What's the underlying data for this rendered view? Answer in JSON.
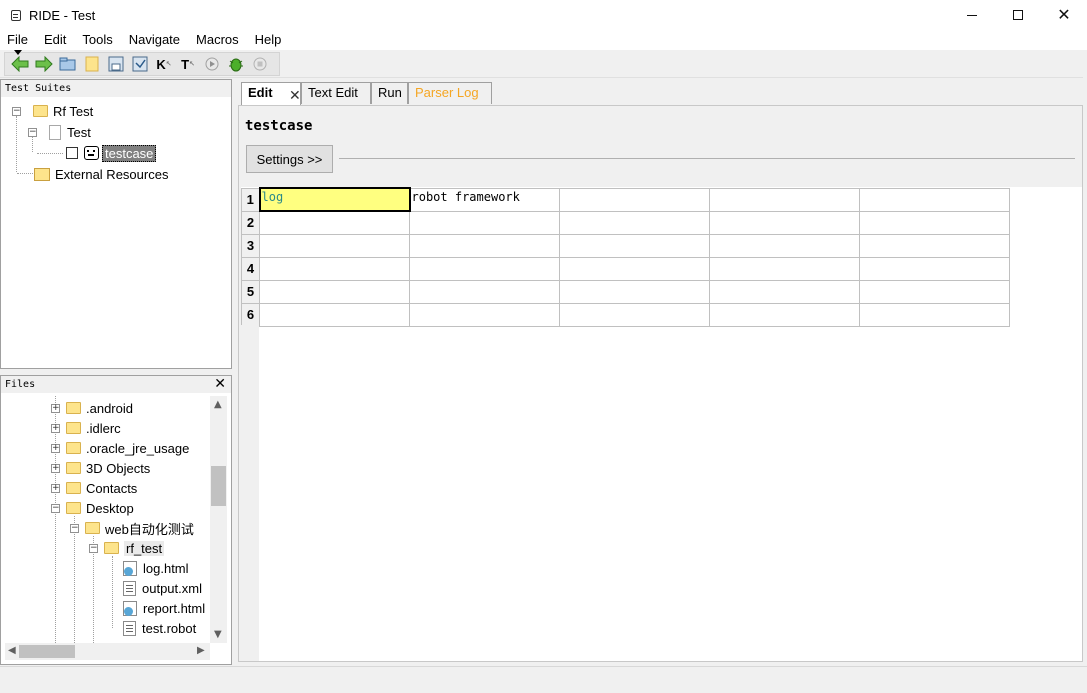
{
  "window": {
    "title": "RIDE - Test"
  },
  "menu": [
    "File",
    "Edit",
    "Tools",
    "Navigate",
    "Macros",
    "Help"
  ],
  "toolbar": {
    "icons": [
      "back-arrow-icon",
      "forward-arrow-icon",
      "open-suite-icon",
      "open-directory-icon",
      "save-icon",
      "save-all-icon",
      "keyword-search-icon",
      "test-search-icon",
      "run-icon",
      "debug-icon",
      "stop-icon"
    ],
    "k_label": "K",
    "t_label": "T"
  },
  "suites_panel": {
    "header": "Test Suites",
    "tree": {
      "root": "Rf Test",
      "child": "Test",
      "testcase": "testcase",
      "external": "External Resources"
    }
  },
  "files_panel": {
    "header": "Files",
    "close": "✕",
    "items": [
      ".android",
      ".idlerc",
      ".oracle_jre_usage",
      "3D Objects",
      "Contacts",
      "Desktop",
      "web自动化测试",
      "rf_test",
      "log.html",
      "output.xml",
      "report.html",
      "test.robot"
    ]
  },
  "tabs": {
    "edit": "Edit",
    "text_edit": "Text Edit",
    "run": "Run",
    "parser_log": "Parser Log",
    "close": "✕"
  },
  "editor": {
    "title": "testcase",
    "settings_button": "Settings >>",
    "rows": [
      {
        "num": "1",
        "cells": [
          "log",
          "robot framework",
          "",
          "",
          ""
        ]
      },
      {
        "num": "2",
        "cells": [
          "",
          "",
          "",
          "",
          ""
        ]
      },
      {
        "num": "3",
        "cells": [
          "",
          "",
          "",
          "",
          ""
        ]
      },
      {
        "num": "4",
        "cells": [
          "",
          "",
          "",
          "",
          ""
        ]
      },
      {
        "num": "5",
        "cells": [
          "",
          "",
          "",
          "",
          ""
        ]
      },
      {
        "num": "6",
        "cells": [
          "",
          "",
          "",
          "",
          ""
        ]
      }
    ]
  }
}
